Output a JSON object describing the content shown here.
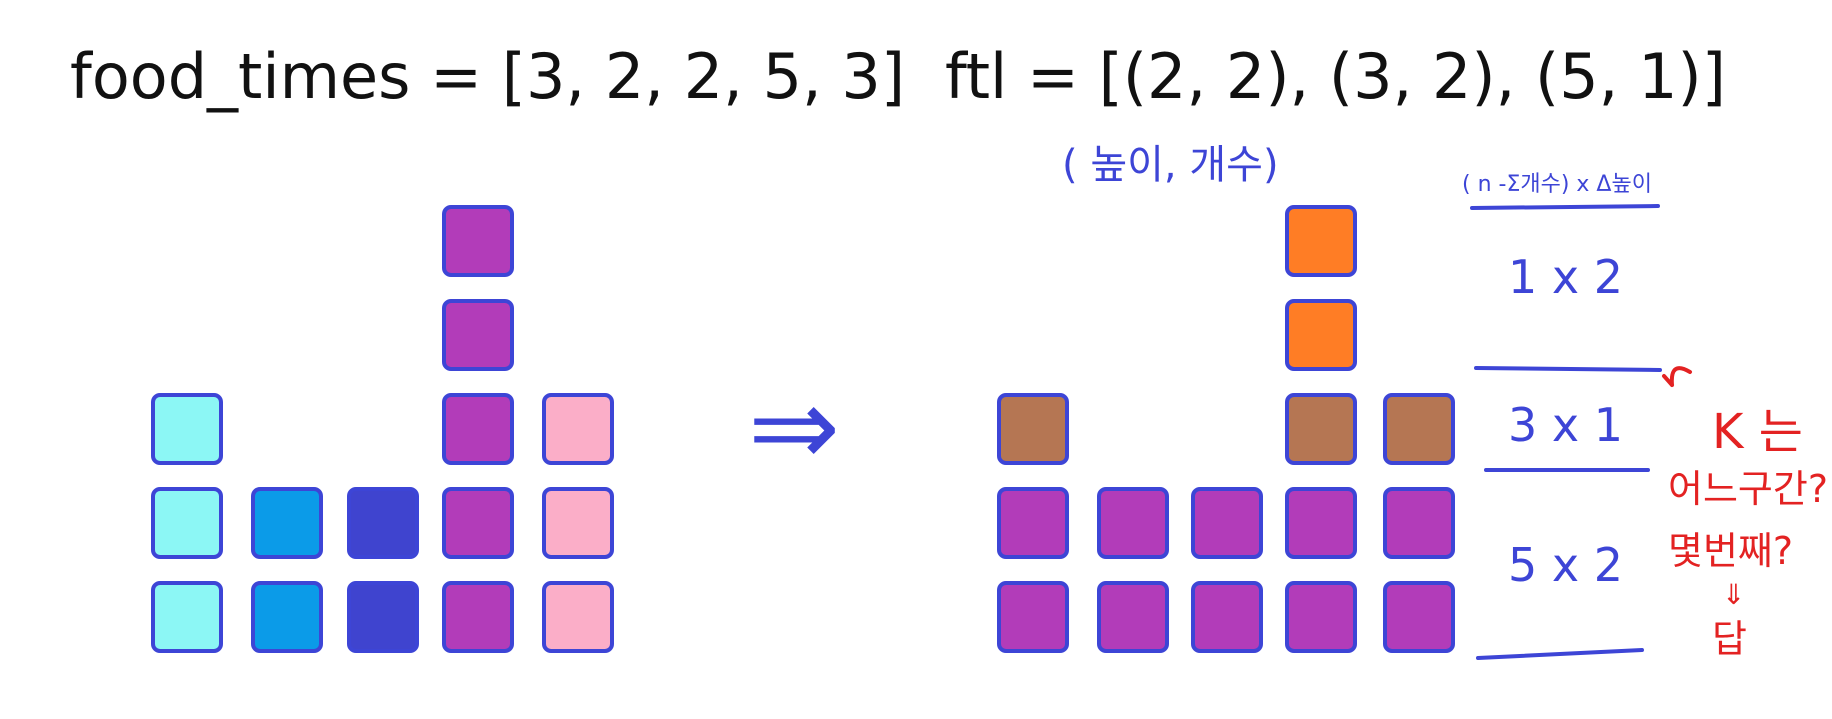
{
  "left_title": "food_times = [3, 2, 2, 5, 3]",
  "right_title": "ftl = [(2, 2), (3, 2), (5, 1)]",
  "pair_legend": "( 높이, 개수)",
  "formula_header": "( n -Σ개수) x Δ높이",
  "intervals": [
    "1 x 2",
    "3 x 1",
    "5 x 2"
  ],
  "arrow_symbol": "⇒",
  "question": {
    "line1": "K 는",
    "line2": "어느구간?",
    "line3": "몇번째?",
    "arrow": "⇓",
    "answer": "답"
  },
  "colors": {
    "outline": "#3d45d6",
    "cyan": "#8cf7f5",
    "sky": "#0b9be8",
    "navy": "#3f44cf",
    "purple": "#b23cb9",
    "pink": "#fbaec8",
    "orange": "#ff7d25",
    "brown": "#b57653",
    "ink_blue": "#3d45d6",
    "ink_red": "#e32222"
  },
  "left_columns": [
    {
      "height": 3,
      "color": "cyan"
    },
    {
      "height": 2,
      "color": "sky"
    },
    {
      "height": 2,
      "color": "navy"
    },
    {
      "height": 5,
      "color": "purple"
    },
    {
      "height": 3,
      "color": "pink"
    }
  ],
  "right_columns": [
    {
      "height": 3,
      "layers": [
        "purple",
        "purple",
        "brown"
      ]
    },
    {
      "height": 2,
      "layers": [
        "purple",
        "purple"
      ]
    },
    {
      "height": 2,
      "layers": [
        "purple",
        "purple"
      ]
    },
    {
      "height": 5,
      "layers": [
        "purple",
        "purple",
        "brown",
        "orange",
        "orange"
      ]
    },
    {
      "height": 3,
      "layers": [
        "purple",
        "purple",
        "brown"
      ]
    }
  ]
}
